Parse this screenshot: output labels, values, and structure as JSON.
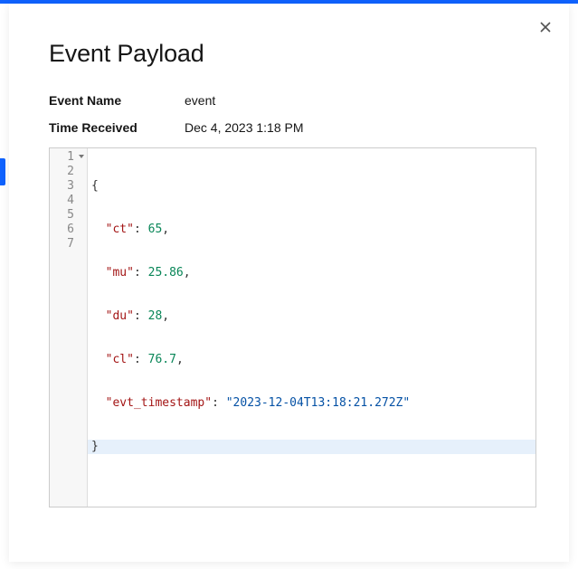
{
  "modal": {
    "title": "Event Payload",
    "close_label": "Close",
    "fields": {
      "event_name": {
        "label": "Event Name",
        "value": "event"
      },
      "time_received": {
        "label": "Time Received",
        "value": "Dec 4, 2023 1:18 PM"
      }
    }
  },
  "code": {
    "line_numbers": [
      "1",
      "2",
      "3",
      "4",
      "5",
      "6",
      "7"
    ],
    "payload": {
      "ct": 65,
      "mu": 25.86,
      "du": 28,
      "cl": 76.7,
      "evt_timestamp": "2023-12-04T13:18:21.272Z"
    },
    "tokens": {
      "brace_open": "{",
      "brace_close": "}",
      "k_ct": "\"ct\"",
      "v_ct": "65",
      "k_mu": "\"mu\"",
      "v_mu": "25.86",
      "k_du": "\"du\"",
      "v_du": "28",
      "k_cl": "\"cl\"",
      "v_cl": "76.7",
      "k_ts": "\"evt_timestamp\"",
      "v_ts": "\"2023-12-04T13:18:21.272Z\"",
      "colon": ":",
      "comma": ","
    }
  }
}
